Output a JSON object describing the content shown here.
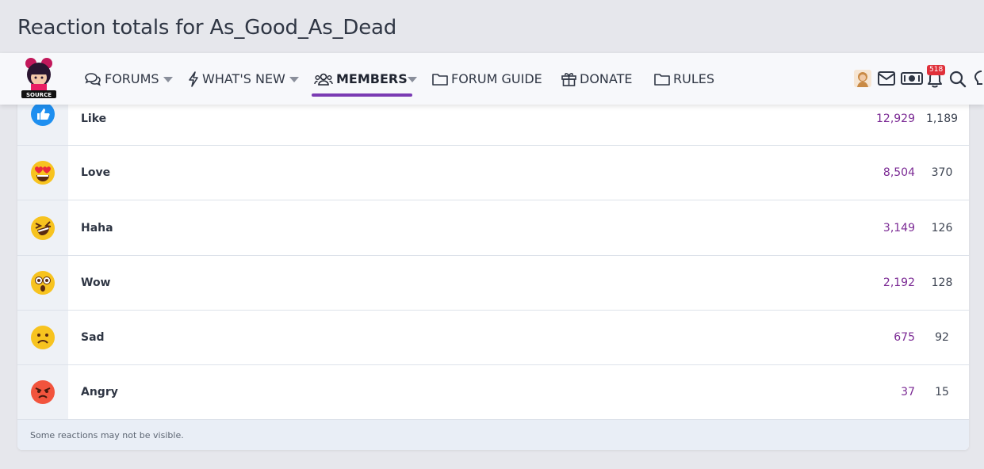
{
  "page": {
    "title": "Reaction totals for As_Good_As_Dead"
  },
  "nav": {
    "items": [
      {
        "label": "FORUMS"
      },
      {
        "label": "WHAT'S NEW"
      },
      {
        "label": "MEMBERS"
      },
      {
        "label": "FORUM GUIDE"
      },
      {
        "label": "DONATE"
      },
      {
        "label": "RULES"
      }
    ],
    "logo_text": "SOURCE",
    "notification_count": "518"
  },
  "reactions": [
    {
      "name": "Like",
      "given": "12,929",
      "received": "1,189"
    },
    {
      "name": "Love",
      "given": "8,504",
      "received": "370"
    },
    {
      "name": "Haha",
      "given": "3,149",
      "received": "126"
    },
    {
      "name": "Wow",
      "given": "2,192",
      "received": "128"
    },
    {
      "name": "Sad",
      "given": "675",
      "received": "92"
    },
    {
      "name": "Angry",
      "given": "37",
      "received": "15"
    }
  ],
  "footer": {
    "note": "Some reactions may not be visible."
  },
  "colors": {
    "accent": "#7a3bb3",
    "given_text": "#7b2a94",
    "badge": "#e0303a"
  }
}
